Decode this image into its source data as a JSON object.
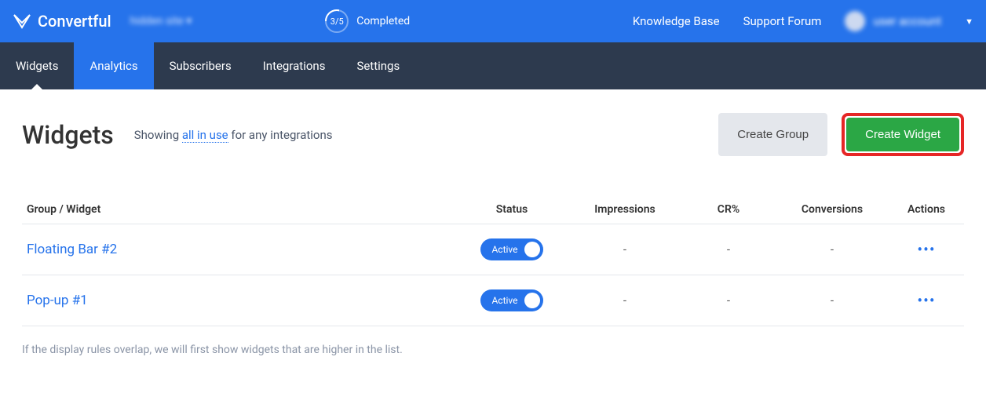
{
  "brand": {
    "name": "Convertful"
  },
  "topbar": {
    "site_selector": "hidden site ▾",
    "progress": {
      "fraction": "3/5",
      "label": "Completed"
    },
    "links": {
      "kb": "Knowledge Base",
      "forum": "Support Forum"
    },
    "account": {
      "name": "user account"
    }
  },
  "nav": {
    "items": [
      {
        "label": "Widgets"
      },
      {
        "label": "Analytics"
      },
      {
        "label": "Subscribers"
      },
      {
        "label": "Integrations"
      },
      {
        "label": "Settings"
      }
    ]
  },
  "page": {
    "title": "Widgets",
    "subtitle_prefix": "Showing ",
    "subtitle_link": "all in use",
    "subtitle_suffix": " for any integrations",
    "create_group": "Create Group",
    "create_widget": "Create Widget"
  },
  "table": {
    "headers": {
      "group": "Group / Widget",
      "status": "Status",
      "impressions": "Impressions",
      "cr": "CR%",
      "conversions": "Conversions",
      "actions": "Actions"
    },
    "rows": [
      {
        "name": "Floating Bar #2",
        "status_label": "Active",
        "impressions": "-",
        "cr": "-",
        "conversions": "-"
      },
      {
        "name": "Pop-up #1",
        "status_label": "Active",
        "impressions": "-",
        "cr": "-",
        "conversions": "-"
      }
    ]
  },
  "footnote": "If the display rules overlap, we will first show widgets that are higher in the list."
}
